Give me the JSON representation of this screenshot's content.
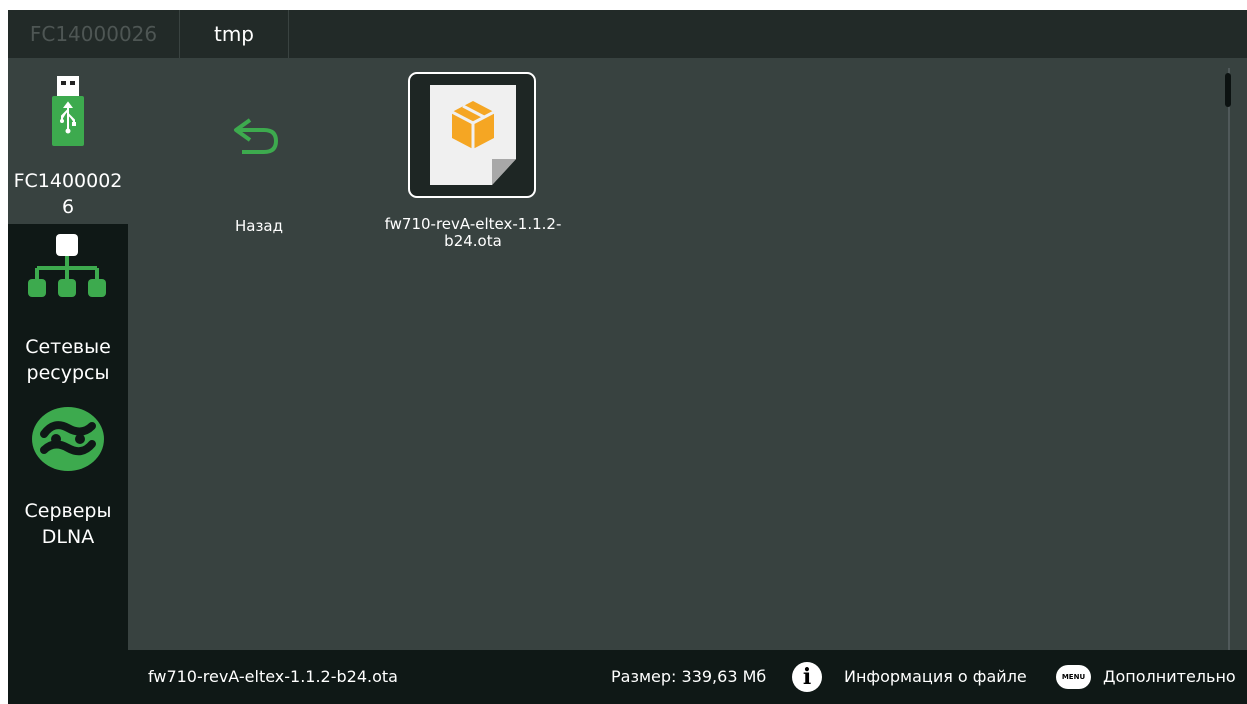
{
  "breadcrumb": {
    "root": "FC14000026",
    "current": "tmp"
  },
  "sidebar": {
    "items": [
      {
        "label": "FC14000026",
        "icon": "usb-drive-icon"
      },
      {
        "label": "Сетевые ресурсы",
        "icon": "network-tree-icon"
      },
      {
        "label": "Серверы DLNA",
        "icon": "dlna-icon"
      }
    ]
  },
  "content": {
    "items": [
      {
        "label": "Назад",
        "icon": "back-arrow-icon"
      },
      {
        "label": "fw710-revA-eltex-1.1.2-b24.ota",
        "icon": "package-file-icon",
        "selected": true
      }
    ]
  },
  "status": {
    "filename": "fw710-revA-eltex-1.1.2-b24.ota",
    "size": "Размер: 339,63 Мб",
    "info_key": "i",
    "info_label": "Информация о файле",
    "menu_key": "MENU",
    "menu_label": "Дополнительно"
  },
  "colors": {
    "accent_green": "#3daa4e",
    "package_orange": "#f5a623",
    "background": "#384240",
    "sidebar": "#0f1816"
  }
}
